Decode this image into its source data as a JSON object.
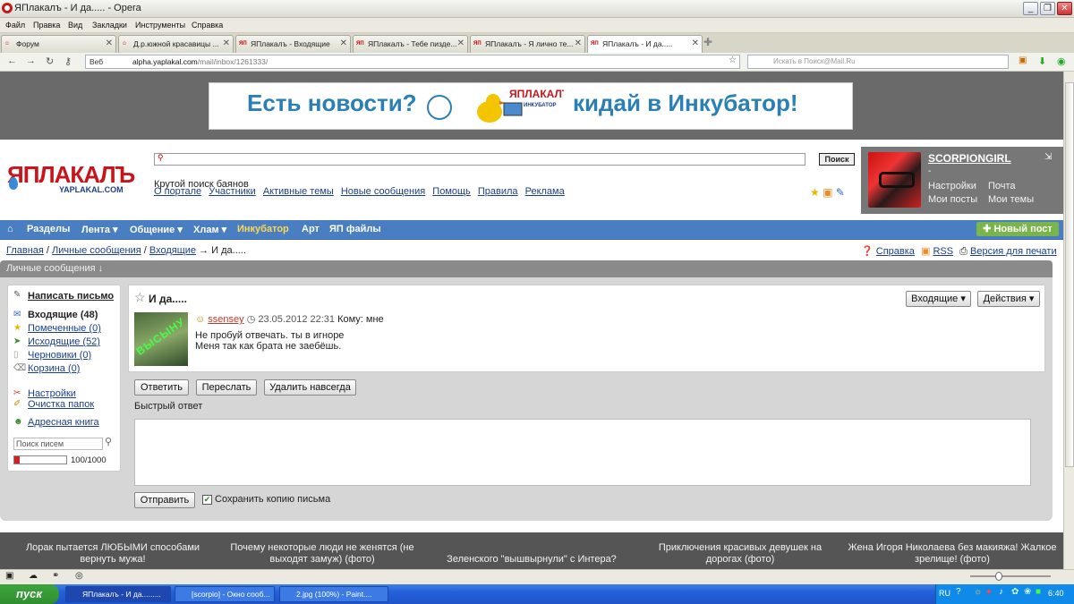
{
  "window": {
    "title": "ЯПлакалъ - И да..... - Opera",
    "min": "_",
    "max": "❐",
    "close": "✕"
  },
  "menu": [
    "Файл",
    "Правка",
    "Вид",
    "Закладки",
    "Инструменты",
    "Справка"
  ],
  "tabs": [
    {
      "label": "Форум"
    },
    {
      "label": "Д.р.южной красавицы ..."
    },
    {
      "label": "ЯПлакалъ - Входящие"
    },
    {
      "label": "ЯПлакалъ - Тебе пизде..."
    },
    {
      "label": "ЯПлакалъ - Я лично те..."
    },
    {
      "label": "ЯПлакалъ - И да....."
    }
  ],
  "address": {
    "web_label": "Веб",
    "host": "alpha.yaplakal.com",
    "path": "/mail/inbox/1261333/",
    "search_placeholder": "Искать в Поиск@Mail.Ru"
  },
  "banner": {
    "text_left": "Есть новости?",
    "brand": "ЯПЛАКАЛЪ",
    "sub": "ИНКУБАТОР",
    "text_right": "кидай в Инкубатор!"
  },
  "site": {
    "logo": "ЯПЛАКАЛЪ",
    "logo_sub": "YAPLAKAL.COM",
    "search_button": "Поиск",
    "smart_search": "Крутой поиск баянов",
    "top_links": [
      "О портале",
      "Участники",
      "Активные темы",
      "Новые сообщения",
      "Помощь",
      "Правила",
      "Реклама"
    ]
  },
  "user": {
    "name": "SCORPIONGIRL",
    "dash": "-",
    "links": [
      "Настройки",
      "Почта",
      "Мои посты",
      "Мои темы"
    ]
  },
  "nav": {
    "items": [
      "Разделы",
      "Лента ▾",
      "Общение ▾",
      "Хлам ▾",
      "Инкубатор",
      "Арт",
      "ЯП файлы"
    ],
    "new_post": "Новый пост"
  },
  "breadcrumb": {
    "home": "Главная",
    "pm": "Личные сообщения",
    "inbox": "Входящие",
    "current": "→ И да.....",
    "help": "Справка",
    "rss": "RSS",
    "print": "Версия для печати"
  },
  "pm": {
    "header": "Личные сообщения ↓",
    "compose": "Написать письмо",
    "folders": [
      {
        "label": "Входящие (48)",
        "icon": "inbox-icon",
        "glyph": "✉",
        "color": "#2a6bc0"
      },
      {
        "label": "Помеченные (0)",
        "icon": "star-icon",
        "glyph": "★",
        "color": "#e8b800"
      },
      {
        "label": "Исходящие (52)",
        "icon": "outbox-icon",
        "glyph": "➤",
        "color": "#3a8a2a"
      },
      {
        "label": "Черновики (0)",
        "icon": "draft-icon",
        "glyph": "▯",
        "color": "#999"
      },
      {
        "label": "Корзина (0)",
        "icon": "trash-icon",
        "glyph": "🗑",
        "color": "#777"
      }
    ],
    "settings": "Настройки",
    "cleanup": "Очистка папок",
    "address_book": "Адресная книга",
    "search_placeholder": "Поиск писем",
    "quota": "100/1000",
    "quota_fraction": 0.1
  },
  "message": {
    "title": "И да.....",
    "sender": "ssensey",
    "date": "23.05.2012 22:31",
    "to": "Кому: мне",
    "avatar_text": "ВЫСЫНУ",
    "body_line1": "Не пробуй отвечать. ты в игноре",
    "body_line2": "Меня так как брата не заебёшь.",
    "folder_button": "Входящие ▾",
    "actions_button": "Действия ▾"
  },
  "actions": {
    "reply": "Ответить",
    "forward": "Переслать",
    "delete": "Удалить навсегда",
    "quick_reply": "Быстрый ответ",
    "send": "Отправить",
    "save_copy": "Сохранить копию письма"
  },
  "footer_links": [
    "Лорак пытается ЛЮБЫМИ способами вернуть мужа!",
    "Почему некоторые люди не женятся (не выходят замуж) (фото)",
    "Зеленского \"вышвырнули\" с Интера?",
    "Приключения красивых девушек на дорогах (фото)",
    "Жена Игоря Николаева без макияжа! Жалкое зрелище! (фото)"
  ],
  "taskbar": {
    "start": "пуск",
    "tasks": [
      "ЯПлакалъ - И да.........",
      "[scorpio] - Окно сооб...",
      "2.jpg (100%) - Paint...."
    ],
    "lang": "RU",
    "clock": "6:40"
  },
  "colors": {
    "brand_red": "#c8151b",
    "nav_blue": "#4a7ec2",
    "link_blue": "#1a3f8b",
    "banner_blue": "#2a7fb5"
  }
}
